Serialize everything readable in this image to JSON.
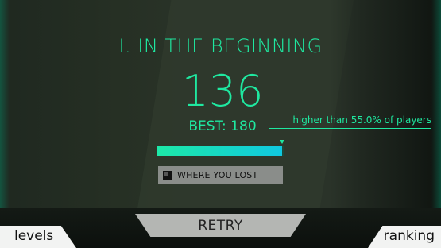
{
  "level": {
    "title": "I. IN THE BEGINNING"
  },
  "result": {
    "score": "136",
    "best": "BEST: 180",
    "percentile_text": "higher than 55.0% of players",
    "progress_fraction": 0.98
  },
  "buttons": {
    "where_you_lost": "WHERE YOU LOST",
    "retry": "RETRY",
    "levels": "levels",
    "ranking": "ranking"
  },
  "colors": {
    "accent": "#1fe8a0",
    "progress_start": "#1de9a8",
    "progress_end": "#10c8e0",
    "button_gray": "#8a8d8a",
    "retry_gray": "#b4b6b3",
    "nav_white": "#f2f3f2"
  },
  "icons": {
    "where_you_lost": "map-square-icon",
    "progress_marker": "triangle-down-icon"
  }
}
